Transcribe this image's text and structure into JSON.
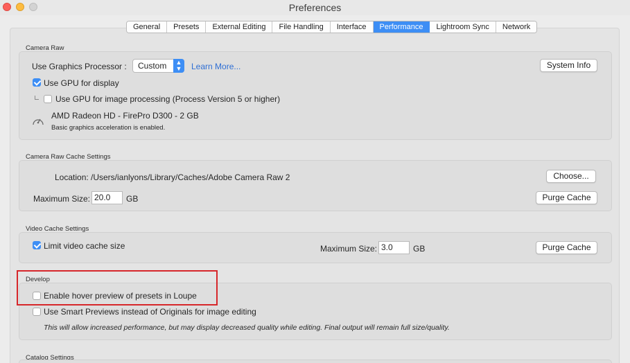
{
  "window": {
    "title": "Preferences"
  },
  "tabs": [
    {
      "label": "General"
    },
    {
      "label": "Presets"
    },
    {
      "label": "External Editing"
    },
    {
      "label": "File Handling"
    },
    {
      "label": "Interface"
    },
    {
      "label": "Performance",
      "active": true
    },
    {
      "label": "Lightroom Sync"
    },
    {
      "label": "Network"
    }
  ],
  "camera_raw": {
    "section_title": "Camera Raw",
    "gpu_label": "Use Graphics Processor :",
    "gpu_value": "Custom",
    "learn_more": "Learn More...",
    "system_info": "System Info",
    "use_gpu_display": "Use GPU for display",
    "use_gpu_display_checked": true,
    "use_gpu_processing": "Use GPU for image processing (Process Version 5 or higher)",
    "use_gpu_processing_checked": false,
    "gpu_name": "AMD Radeon HD - FirePro D300 - 2 GB",
    "gpu_status": "Basic graphics acceleration is enabled."
  },
  "cache": {
    "section_title": "Camera Raw Cache Settings",
    "location_label": "Location:",
    "location_value": "/Users/ianlyons/Library/Caches/Adobe Camera Raw 2",
    "choose": "Choose...",
    "max_size_label": "Maximum Size:",
    "max_size_value": "20.0",
    "unit": "GB",
    "purge": "Purge Cache"
  },
  "video": {
    "section_title": "Video Cache Settings",
    "limit_label": "Limit video cache size",
    "limit_checked": true,
    "max_size_label": "Maximum Size:",
    "max_size_value": "3.0",
    "unit": "GB",
    "purge": "Purge Cache"
  },
  "develop": {
    "section_title": "Develop",
    "hover_preview": "Enable hover preview of presets in Loupe",
    "hover_preview_checked": false,
    "smart_previews": "Use Smart Previews instead of Originals for image editing",
    "smart_previews_checked": false,
    "note": "This will allow increased performance, but may display decreased quality while editing. Final output will remain full size/quality."
  },
  "catalog": {
    "section_title": "Catalog Settings"
  },
  "colors": {
    "accent": "#3d8ef5",
    "highlight": "#d6262a"
  }
}
